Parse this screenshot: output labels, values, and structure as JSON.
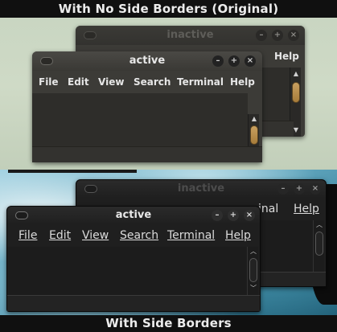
{
  "top_banner": "With No Side Borders (Original)",
  "bottom_banner": "With Side Borders",
  "top_panel": {
    "inactive_window": {
      "title": "inactive",
      "visible_menu": "Help",
      "controls": [
        "minimize-icon",
        "maximize-icon",
        "close-icon"
      ]
    },
    "active_window": {
      "title": "active",
      "menu": [
        "File",
        "Edit",
        "View",
        "Search",
        "Terminal",
        "Help"
      ],
      "controls": [
        "minimize-icon",
        "maximize-icon",
        "close-icon"
      ],
      "scrollbar_thumb_color": "#b88c4a"
    }
  },
  "bottom_panel": {
    "inactive_window": {
      "title": "inactive",
      "visible_menu_partial": "inal",
      "visible_menu": "Help",
      "controls": [
        "minimize-icon",
        "maximize-icon",
        "close-icon"
      ]
    },
    "active_window": {
      "title": "active",
      "menu": [
        "File",
        "Edit",
        "View",
        "Search",
        "Terminal",
        "Help"
      ],
      "controls": [
        "minimize-icon",
        "maximize-icon",
        "close-icon"
      ]
    }
  },
  "colors": {
    "window_bg": "#3c3b37",
    "scroll_accent": "#b88c4a",
    "top_background": "#cbd7c3",
    "bottom_background": "#5fa5bd"
  }
}
